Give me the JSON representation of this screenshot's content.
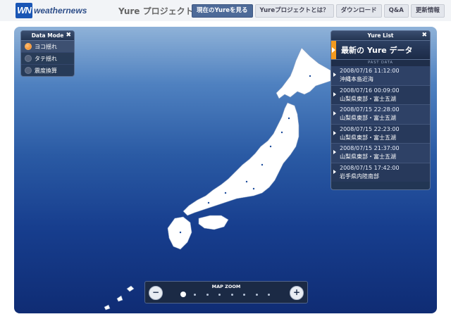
{
  "header": {
    "logo_mark": "WN",
    "logo_text": "weathernews",
    "title": "Yure プロジェクト",
    "nav": [
      {
        "label": "現在のYureを見る",
        "active": true
      },
      {
        "label": "Yureプロジェクトとは？",
        "active": false
      },
      {
        "label": "ダウンロード",
        "active": false
      },
      {
        "label": "Q&A",
        "active": false
      },
      {
        "label": "更新情報",
        "active": false
      }
    ]
  },
  "data_mode": {
    "title": "Data Mode",
    "close": "✖",
    "options": [
      {
        "label": "ヨコ揺れ",
        "selected": true
      },
      {
        "label": "タテ揺れ",
        "selected": false
      },
      {
        "label": "震度換算",
        "selected": false
      }
    ]
  },
  "yure_list": {
    "title": "Yure List",
    "close": "✖",
    "latest_label": "最新の Yure データ",
    "past_label": "PAST DATA",
    "entries": [
      {
        "date": "2008/07/16 11:12:00",
        "place": "沖縄本島近海"
      },
      {
        "date": "2008/07/16 00:09:00",
        "place": "山梨県東部・富士五湖"
      },
      {
        "date": "2008/07/15 22:28:00",
        "place": "山梨県東部・富士五湖"
      },
      {
        "date": "2008/07/15 22:23:00",
        "place": "山梨県東部・富士五湖"
      },
      {
        "date": "2008/07/15 21:37:00",
        "place": "山梨県東部・富士五湖"
      },
      {
        "date": "2008/07/15 17:42:00",
        "place": "岩手県内陸南部"
      }
    ]
  },
  "map_zoom": {
    "label": "MAP ZOOM",
    "minus_icon": "zoom-out-icon",
    "plus_icon": "zoom-in-icon",
    "levels": 8,
    "current_level": 1
  },
  "colors": {
    "accent": "#f39a1e",
    "nav_active": "#4d6a98",
    "map_top": "#8fb2d8",
    "map_bottom": "#0f2c74"
  }
}
